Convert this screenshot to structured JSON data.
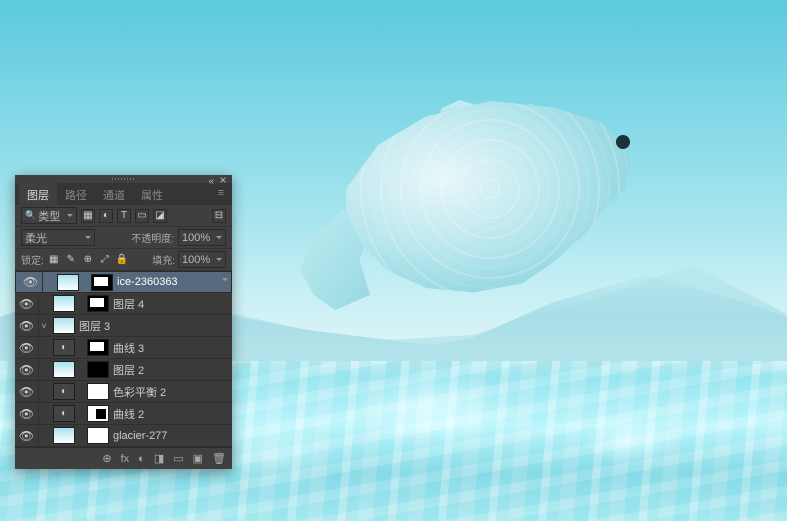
{
  "tabs": {
    "layers": "图层",
    "paths": "路径",
    "channels": "通道",
    "properties": "属性"
  },
  "filter": {
    "kind_label": "类型",
    "filters": [
      "▦",
      "◐",
      "T",
      "▭",
      "◪"
    ]
  },
  "blend": {
    "mode": "柔光",
    "opacity_label": "不透明度:",
    "opacity_value": "100%"
  },
  "lock": {
    "label": "锁定:",
    "fill_label": "填充:",
    "fill_value": "100%",
    "icons": [
      "▦",
      "✎",
      "⊕",
      "⤢",
      "🔒"
    ]
  },
  "layers": [
    {
      "name": "ice-2360363",
      "selected": true,
      "thumbs": [
        "img",
        "link",
        "mask"
      ],
      "chev": ""
    },
    {
      "name": "图层 4",
      "selected": false,
      "thumbs": [
        "img",
        "link",
        "mask"
      ],
      "chev": ""
    },
    {
      "name": "图层 3",
      "selected": false,
      "thumbs": [
        "img"
      ],
      "chev": "˅"
    },
    {
      "name": "曲线 3",
      "selected": false,
      "thumbs": [
        "adj",
        "link",
        "mask"
      ],
      "chev": ""
    },
    {
      "name": "图层 2",
      "selected": false,
      "thumbs": [
        "img",
        "link",
        "mask-inv"
      ],
      "chev": ""
    },
    {
      "name": "色彩平衡 2",
      "selected": false,
      "thumbs": [
        "adj",
        "link",
        "mask-w"
      ],
      "chev": ""
    },
    {
      "name": "曲线 2",
      "selected": false,
      "thumbs": [
        "adj",
        "link",
        "mask-w-inv"
      ],
      "chev": ""
    },
    {
      "name": "glacier-277",
      "selected": false,
      "thumbs": [
        "img",
        "link",
        "mask-w"
      ],
      "chev": ""
    }
  ],
  "footer": {
    "icons": [
      "⊕",
      "fx",
      "◐",
      "◨",
      "▭",
      "▣",
      "🗑"
    ]
  }
}
